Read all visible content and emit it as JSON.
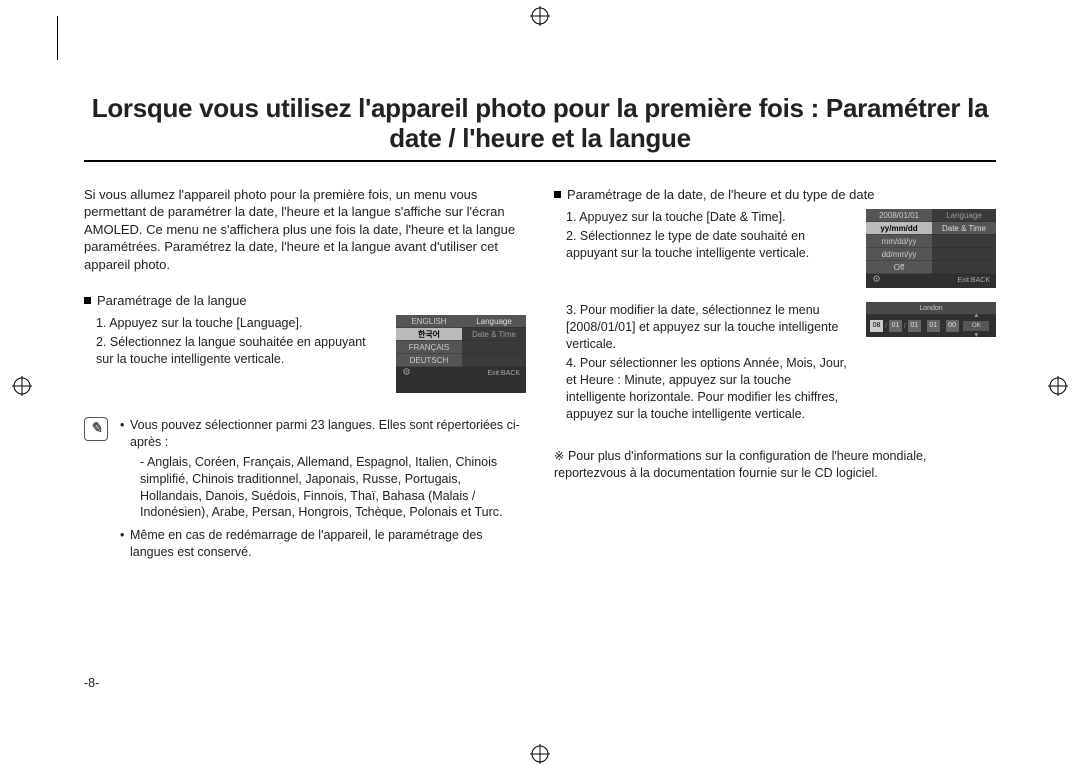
{
  "title": "Lorsque vous utilisez l'appareil photo pour la première fois : Paramétrer la date / l'heure et la langue",
  "intro": "Si vous allumez l'appareil photo pour la première fois, un menu vous permettant de paramétrer la date, l'heure et la langue s'affiche sur l'écran AMOLED. Ce menu ne s'affichera plus une fois la date, l'heure et la langue paramétrées. Paramétrez la date, l'heure et la langue avant d'utiliser cet appareil photo.",
  "sec_lang": {
    "heading": "Paramétrage de la langue",
    "step1": "1. Appuyez sur la touche [Language].",
    "step2": "2. Sélectionnez la langue souhaitée en appuyant sur la touche intelligente verticale."
  },
  "note": {
    "li1": "Vous pouvez sélectionner parmi 23 langues. Elles sont répertoriées ci-après :",
    "langs": "- Anglais, Coréen, Français, Allemand, Espagnol, Italien, Chinois simplifié, Chinois traditionnel, Japonais, Russe, Portugais, Hollandais, Danois, Suédois, Finnois, Thaï, Bahasa (Malais / Indonésien), Arabe, Persan, Hongrois, Tchèque, Polonais et Turc.",
    "li2": "Même en cas de redémarrage de l'appareil, le paramétrage des langues est conservé."
  },
  "sec_date": {
    "heading": "Paramétrage de la date, de l'heure et du type de date",
    "step1": "1. Appuyez sur la touche [Date & Time].",
    "step2": "2. Sélectionnez le type de date souhaité en appuyant sur la touche intelligente verticale.",
    "step3": "3. Pour modifier la date, sélectionnez le menu [2008/01/01] et appuyez sur la touche intelligente verticale.",
    "step4": "4. Pour sélectionner les options Année, Mois, Jour, et Heure :  Minute, appuyez sur la touche intelligente horizontale. Pour modifier les chiffres, appuyez sur la touche intelligente verticale."
  },
  "asterisk": "※ Pour plus d'informations sur la configuration de l'heure mondiale, reportezvous à la documentation fournie sur le CD logiciel.",
  "pagenum": "-8-",
  "lcd_lang": {
    "items": [
      "ENGLISH",
      "한국어",
      "FRANÇAIS",
      "DEUTSCH"
    ],
    "menu1": "Language",
    "menu2": "Date & Time",
    "exit": "Exit:BACK"
  },
  "lcd_date": {
    "date": "2008/01/01",
    "items": [
      "yy/mm/dd",
      "mm/dd/yy",
      "dd/mm/yy",
      "Off"
    ],
    "menu1": "Language",
    "menu2": "Date & Time",
    "exit": "Exit:BACK"
  },
  "lcd_time": {
    "city": "London",
    "d1": "08",
    "d2": "01",
    "d3": "01",
    "d4": "01",
    "d5": "00",
    "ok": "OK",
    "up": "▲",
    "down": "▼"
  }
}
